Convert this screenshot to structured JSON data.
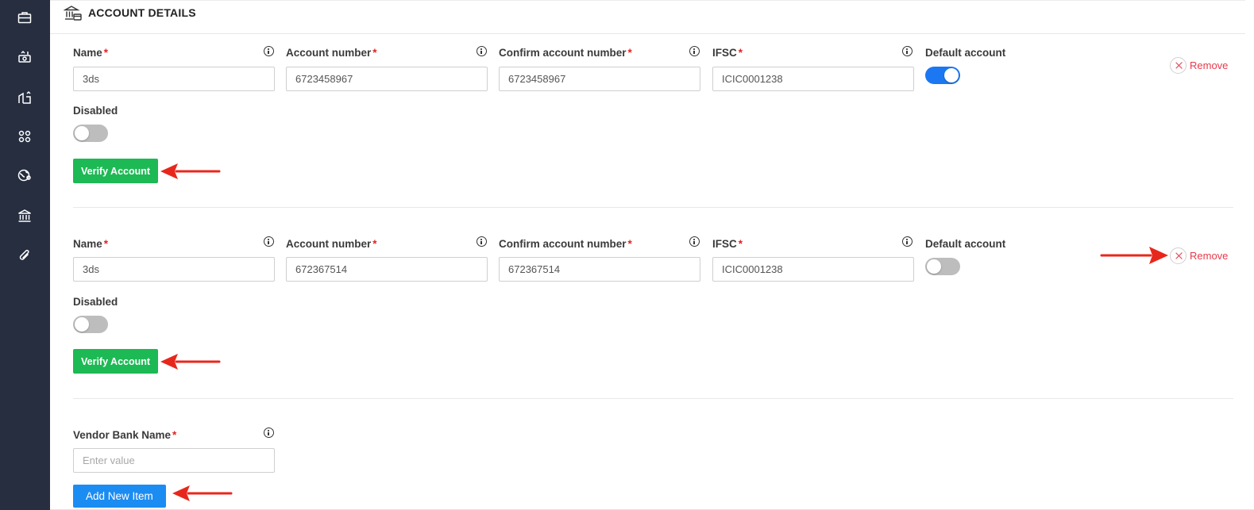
{
  "sidebar": {
    "icons": [
      "briefcase-icon",
      "money-flow-icon",
      "building-chart-icon",
      "grid-apps-icon",
      "globe-pin-icon",
      "bank-icon",
      "paperclip-icon"
    ]
  },
  "section": {
    "title": "ACCOUNT DETAILS",
    "icon": "bank-card-icon"
  },
  "labels": {
    "name": "Name",
    "account_number": "Account number",
    "confirm_account_number": "Confirm account number",
    "ifsc": "IFSC",
    "default_account": "Default account",
    "disabled": "Disabled",
    "required_mark": "*",
    "verify_button": "Verify Account",
    "remove": "Remove"
  },
  "accounts": [
    {
      "name": "3ds",
      "account_number": "6723458967",
      "confirm_account_number": "6723458967",
      "ifsc": "ICIC0001238",
      "default_account": true,
      "disabled": false
    },
    {
      "name": "3ds",
      "account_number": "672367514",
      "confirm_account_number": "672367514",
      "ifsc": "ICIC0001238",
      "default_account": false,
      "disabled": false
    }
  ],
  "vendor_bank": {
    "label": "Vendor Bank Name",
    "placeholder": "Enter value",
    "value": ""
  },
  "add_button": "Add New Item",
  "colors": {
    "sidebar_bg": "#262e40",
    "verify_green": "#1db954",
    "primary_blue": "#1b8cf2",
    "toggle_on": "#1b78f2",
    "remove_red": "#e8394b",
    "annotation_arrow": "#e8271c"
  }
}
